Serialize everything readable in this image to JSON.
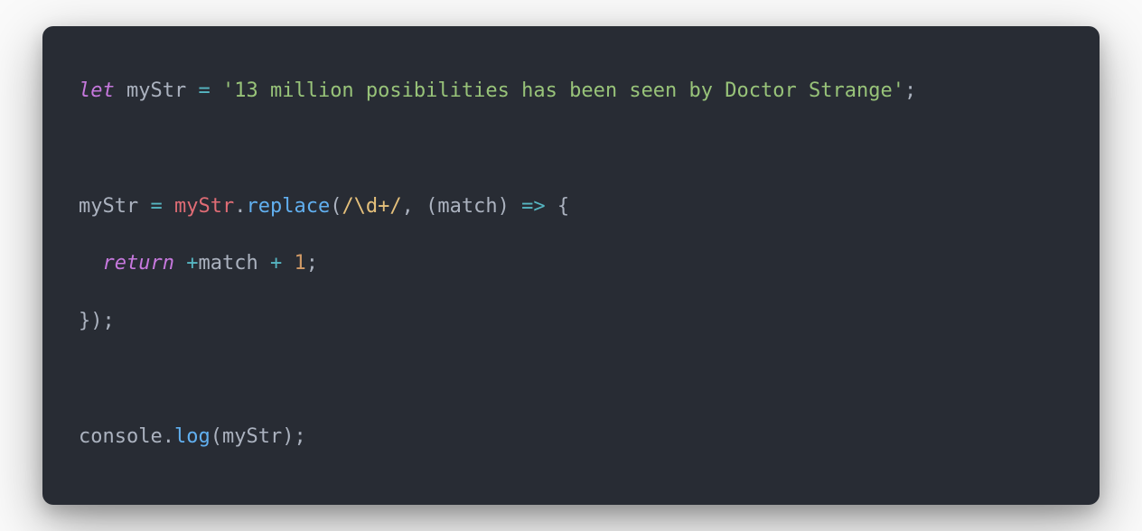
{
  "code": {
    "line1": {
      "let": "let",
      "space1": " ",
      "myStr": "myStr",
      "space2": " ",
      "eq": "=",
      "space3": " ",
      "string": "'13 million posibilities has been seen by Doctor Strange'",
      "semi": ";"
    },
    "line3": {
      "myStr1": "myStr",
      "space1": " ",
      "eq": "=",
      "space2": " ",
      "myStr2": "myStr",
      "dot": ".",
      "replace": "replace",
      "paren1": "(",
      "regex": "/\\d+/",
      "comma": ",",
      "space3": " ",
      "paren2": "(",
      "match": "match",
      "paren3": ")",
      "space4": " ",
      "arrow": "=>",
      "space5": " ",
      "brace": "{"
    },
    "line4": {
      "indent": "  ",
      "return": "return",
      "space1": " ",
      "plus1": "+",
      "match": "match",
      "space2": " ",
      "plus2": "+",
      "space3": " ",
      "one": "1",
      "semi": ";"
    },
    "line5": {
      "brace": "}",
      "paren": ")",
      "semi": ";"
    },
    "line7": {
      "console": "console",
      "dot": ".",
      "log": "log",
      "paren1": "(",
      "myStr": "myStr",
      "paren2": ")",
      "semi": ";"
    }
  }
}
